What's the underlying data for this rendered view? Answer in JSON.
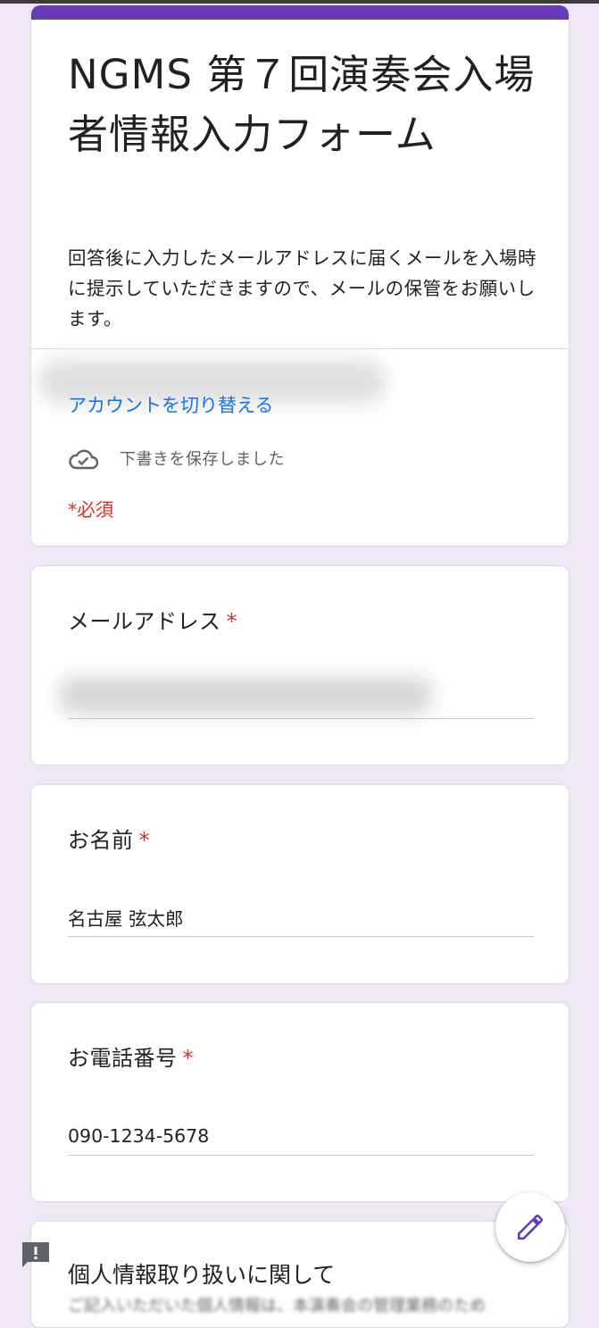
{
  "form": {
    "title": "NGMS 第７回演奏会入場者情報入力フォーム",
    "description": "回答後に入力したメールアドレスに届くメールを入場時に提示していただきますので、メールの保管をお願いします。",
    "switch_account": "アカウントを切り替える",
    "draft_status": "下書きを保存しました",
    "required_note": "*必須"
  },
  "questions": {
    "email": {
      "label": "メールアドレス",
      "required": "*"
    },
    "name": {
      "label": "お名前",
      "required": "*",
      "value": "名古屋 弦太郎"
    },
    "phone": {
      "label": "お電話番号",
      "required": "*",
      "value": "090-1234-5678"
    },
    "privacy": {
      "label": "個人情報取り扱いに関して",
      "subtext": "ご記入いただいた個人情報は、本演奏会の管理業務のため"
    }
  },
  "colors": {
    "accent": "#673ab7",
    "background": "#ede7f6",
    "required": "#d93025",
    "link": "#1a73e8"
  },
  "icons": {
    "cloud": "cloud-check-icon",
    "edit": "pencil-icon",
    "feedback": "feedback-icon"
  }
}
